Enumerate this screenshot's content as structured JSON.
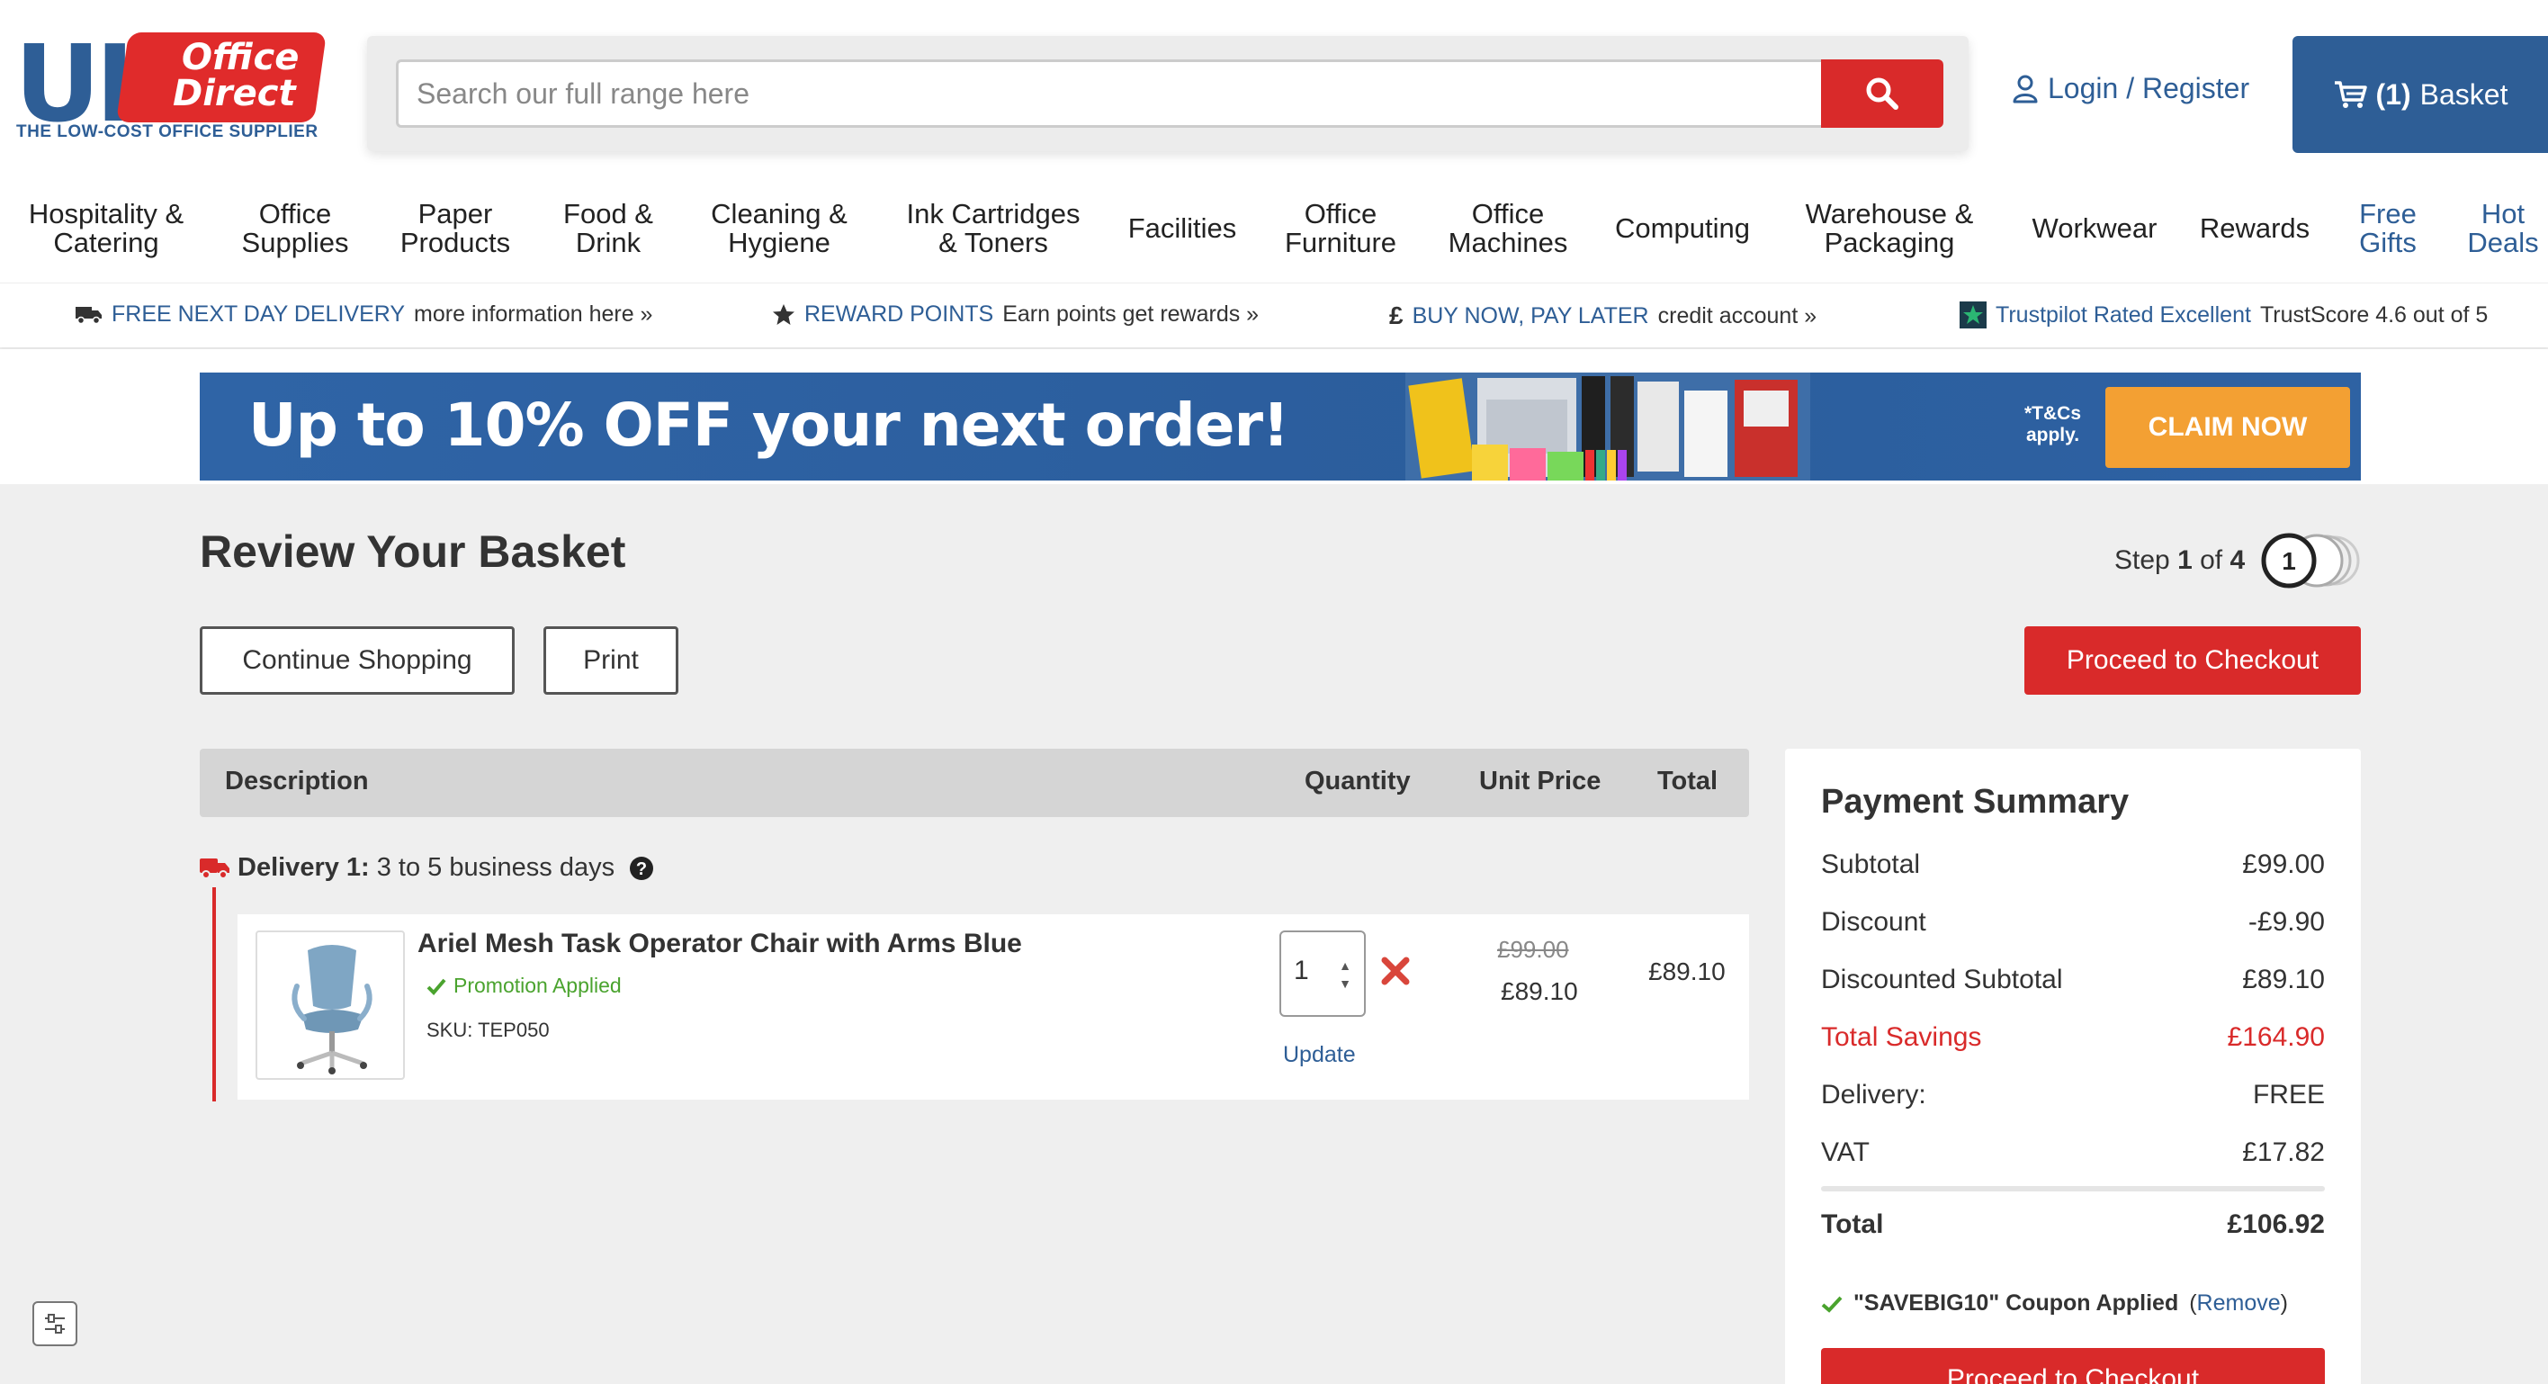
{
  "logo": {
    "line1": "UK",
    "line2": "Office",
    "line3": "Direct",
    "tagline": "THE LOW-COST OFFICE SUPPLIER"
  },
  "search": {
    "placeholder": "Search our full range here",
    "icon": "search-icon"
  },
  "account": {
    "login_label": "Login / Register",
    "icon": "user-icon"
  },
  "basket": {
    "count": "(1)",
    "label": "Basket",
    "icon": "cart-icon"
  },
  "nav": {
    "items": [
      {
        "line1": "Hospitality &",
        "line2": "Catering"
      },
      {
        "line1": "Office",
        "line2": "Supplies"
      },
      {
        "line1": "Paper",
        "line2": "Products"
      },
      {
        "line1": "Food &",
        "line2": "Drink"
      },
      {
        "line1": "Cleaning &",
        "line2": "Hygiene"
      },
      {
        "line1": "Ink Cartridges",
        "line2": "& Toners"
      },
      {
        "line1": "Facilities",
        "line2": ""
      },
      {
        "line1": "Office",
        "line2": "Furniture"
      },
      {
        "line1": "Office",
        "line2": "Machines"
      },
      {
        "line1": "Computing",
        "line2": ""
      },
      {
        "line1": "Warehouse &",
        "line2": "Packaging"
      },
      {
        "line1": "Workwear",
        "line2": ""
      },
      {
        "line1": "Rewards",
        "line2": ""
      },
      {
        "line1": "Free",
        "line2": "Gifts"
      },
      {
        "line1": "Hot",
        "line2": "Deals"
      }
    ]
  },
  "usp": {
    "delivery": {
      "highlight": "FREE NEXT DAY DELIVERY",
      "text": "more information here »",
      "icon": "truck-icon"
    },
    "rewards": {
      "highlight": "REWARD POINTS",
      "text": "Earn points get rewards »",
      "icon": "star-icon"
    },
    "finance": {
      "symbol": "£",
      "highlight": "BUY NOW, PAY LATER",
      "text": "credit account »",
      "icon": "pound-icon"
    },
    "trustpilot": {
      "highlight": "Trustpilot Rated Excellent",
      "text": "TrustScore 4.6 out of 5",
      "icon": "trustpilot-star-icon"
    }
  },
  "banner": {
    "headline": "Up to 10% OFF your next order!",
    "tc_line1": "*T&Cs",
    "tc_line2": "apply.",
    "cta": "CLAIM NOW"
  },
  "page": {
    "title": "Review Your Basket"
  },
  "step": {
    "prefix": "Step",
    "current": "1",
    "of": "of",
    "total": "4",
    "badge": "1"
  },
  "buttons": {
    "continue": "Continue Shopping",
    "print": "Print",
    "checkout": "Proceed to Checkout"
  },
  "table": {
    "headers": {
      "description": "Description",
      "quantity": "Quantity",
      "unit_price": "Unit Price",
      "total": "Total"
    }
  },
  "delivery_group": {
    "label": "Delivery 1:",
    "text": "3 to 5 business days",
    "icon": "truck-icon",
    "help_icon": "question-circle-icon"
  },
  "item": {
    "title": "Ariel Mesh Task Operator Chair with Arms Blue",
    "promotion": "Promotion Applied",
    "sku": "SKU: TEP050",
    "quantity": "1",
    "update": "Update",
    "old_price": "£99.00",
    "unit_price": "£89.10",
    "total": "£89.10"
  },
  "summary": {
    "title": "Payment Summary",
    "rows": [
      {
        "label": "Subtotal",
        "value": "£99.00"
      },
      {
        "label": "Discount",
        "value": "-£9.90"
      },
      {
        "label": "Discounted Subtotal",
        "value": "£89.10"
      },
      {
        "label": "Total Savings",
        "value": "£164.90"
      },
      {
        "label": "Delivery:",
        "value": "FREE"
      },
      {
        "label": "VAT",
        "value": "£17.82"
      }
    ],
    "total": {
      "label": "Total",
      "value": "£106.92"
    },
    "coupon": {
      "text": "\"SAVEBIG10\" Coupon Applied",
      "open": "(",
      "link": "Remove",
      "close": ")"
    },
    "checkout": "Proceed to Checkout"
  },
  "colors": {
    "brand_blue": "#2e5e96",
    "brand_red": "#d92a2a",
    "promo_green": "#4aa32e",
    "cta_orange": "#f3a033"
  }
}
